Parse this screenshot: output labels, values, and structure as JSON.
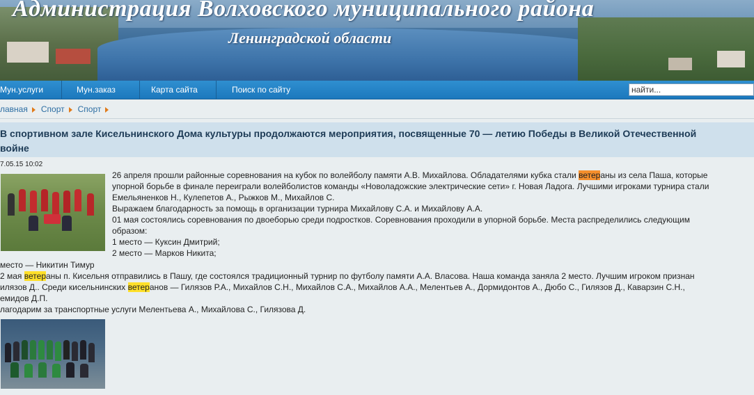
{
  "header": {
    "title": "Администрация Волховского муниципального района",
    "subtitle": "Ленинградской области"
  },
  "nav": {
    "items": [
      "Мун.услуги",
      "Мун.заказ",
      "Карта сайта",
      "Поиск по сайту"
    ],
    "search_value": "найти..."
  },
  "breadcrumb": [
    "лавная",
    "Спорт",
    "Спорт"
  ],
  "article": {
    "title": "В спортивном зале Кисельнинского Дома культуры продолжаются мероприятия, посвященные 70 — летию Победы в Великой Отечественной войне",
    "date": "7.05.15 10:02",
    "p1_a": "26 апреля прошли районные соревнования на кубок по волейболу памяти А.В. Михайлова. Обладателями кубка стали ",
    "p1_hl": "ветер",
    "p1_b": "аны из села Паша, которые",
    "p1_l2": "упорной борьбе в финале переиграли волейболистов команды «Новоладожские электрические сети» г. Новая Ладога. Лучшими игроками турнира стали",
    "p1_l3": "Емельяненков Н., Кулепетов А., Рыжков М., Михайлов С.",
    "p2": "Выражаем благодарность за помощь в организации турнира Михайлову С.А. и Михайлову А.А.",
    "p3_l1": "01 мая состоялись соревнования по двоеборью среди подростков. Соревнования проходили в упорной борьбе. Места распределились следующим",
    "p3_l2": "образом:",
    "place1": "1 место — Куксин Дмитрий;",
    "place2": "2 место — Марков Никита;",
    "place3": " место — Никитин Тимур",
    "p4_a": "2 мая ",
    "p4_hl": "ветер",
    "p4_b": "аны п. Кисельня отправились в Пашу, где состоялся традиционный турнир по футболу памяти А.А. Власова. Наша команда заняла 2 место. Лучшим игроком признан",
    "p4_l2a": "илязов Д.. Среди кисельнинских ",
    "p4_l2hl": "ветер",
    "p4_l2b": "анов — Гилязов Р.А., Михайлов С.Н., Михайлов С.А., Михайлов А.А., Мелентьев А., Дормидонтов А., Дюбо С., Гилязов Д., Каварзин С.Н.,",
    "p4_l3": "емидов Д.П.",
    "p5": "лагодарим за транспортные услуги Мелентьева А., Михайлова С., Гилязова Д."
  },
  "colors": {
    "nav_bg": "#1c78bd",
    "headline_bg": "#cfe0ec",
    "highlight": "#ffe02a",
    "highlight_active": "#f58f2c",
    "link": "#2d6ea3"
  }
}
